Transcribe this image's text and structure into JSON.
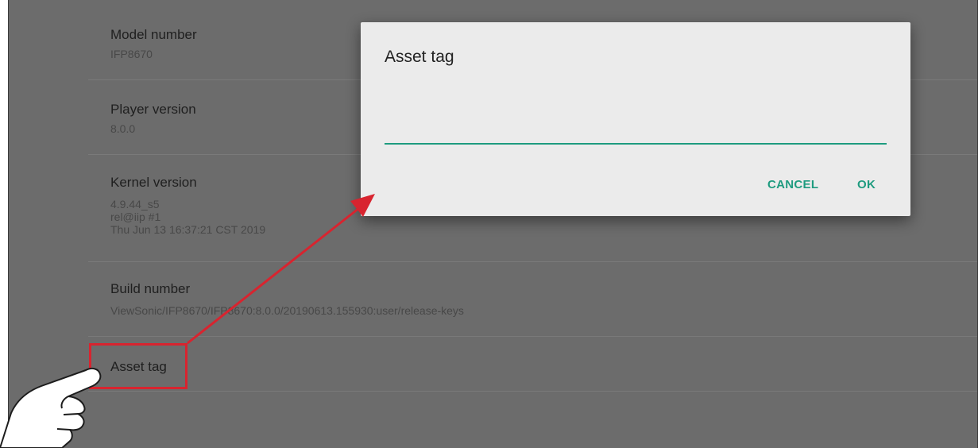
{
  "settings": {
    "items": [
      {
        "title": "Model number",
        "subtitle": "IFP8670"
      },
      {
        "title": "Player version",
        "subtitle": "8.0.0"
      },
      {
        "title": "Kernel version",
        "subtitle": "4.9.44_s5\nrel@iip #1\nThu Jun 13 16:37:21 CST 2019"
      },
      {
        "title": "Build number",
        "subtitle": "ViewSonic/IFP8670/IFP8670:8.0.0/20190613.155930:user/release-keys"
      },
      {
        "title": "Asset tag",
        "subtitle": ""
      }
    ]
  },
  "dialog": {
    "title": "Asset tag",
    "input_value": "",
    "cancel_label": "CANCEL",
    "ok_label": "OK"
  },
  "colors": {
    "screen_bg": "#6c6c6c",
    "dialog_bg": "#ebebeb",
    "accent": "#1e9b7f",
    "annotation_red": "#d8242f"
  },
  "icons": [
    "pointing-hand-icon",
    "arrow-annotation"
  ]
}
